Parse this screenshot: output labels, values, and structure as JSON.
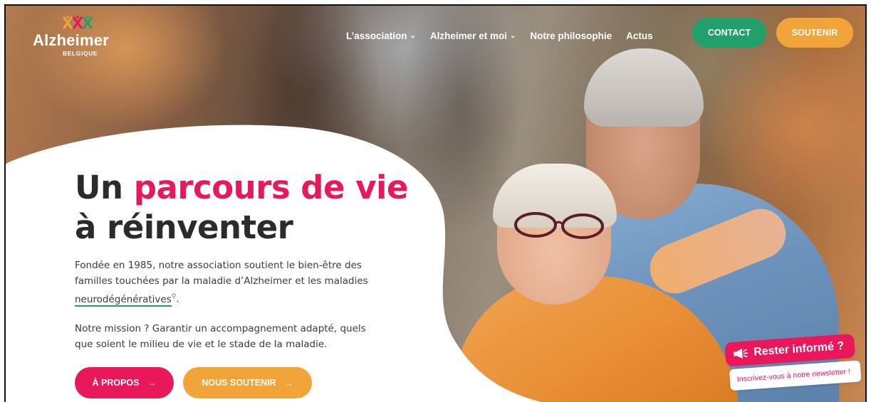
{
  "brand": {
    "name": "Alzheimer",
    "subtitle": "BELGIQUE"
  },
  "nav": {
    "items": [
      {
        "label": "L’association",
        "chevron": "⌄"
      },
      {
        "label": "Alzheimer et moi",
        "chevron": "⌄"
      },
      {
        "label": "Notre philosophie",
        "chevron": ""
      },
      {
        "label": "Actus",
        "chevron": ""
      }
    ],
    "contact_label": "CONTACT",
    "soutenir_label": "SOUTENIR"
  },
  "hero": {
    "title_part1": "Un ",
    "title_accent": "parcours de vie",
    "title_part2": "à réinventer",
    "paragraph1_before": "Fondée en 1985, notre association soutient le bien-être des familles touchées par la maladie d’Alzheimer et les maladies ",
    "paragraph1_link": "neurodégénératives",
    "paragraph1_after": ".",
    "paragraph2": "Notre mission ? Garantir un accompagnement adapté, quels que soient le milieu de vie et le stade de la maladie.",
    "button_apropos": "À PROPOS",
    "button_nous": "NOUS SOUTENIR",
    "arrow": "→"
  },
  "newsletter": {
    "title": "Rester informé ?",
    "subtitle": "Inscrivez-vous à notre newsletter !"
  },
  "colors": {
    "pink": "#e8185a",
    "green": "#22a06b",
    "orange": "#f0a43a"
  },
  "icons": {
    "logo": "people-figures-icon",
    "dropdown": "chevron-down-icon",
    "search": "search-icon",
    "megaphone": "megaphone-icon"
  }
}
